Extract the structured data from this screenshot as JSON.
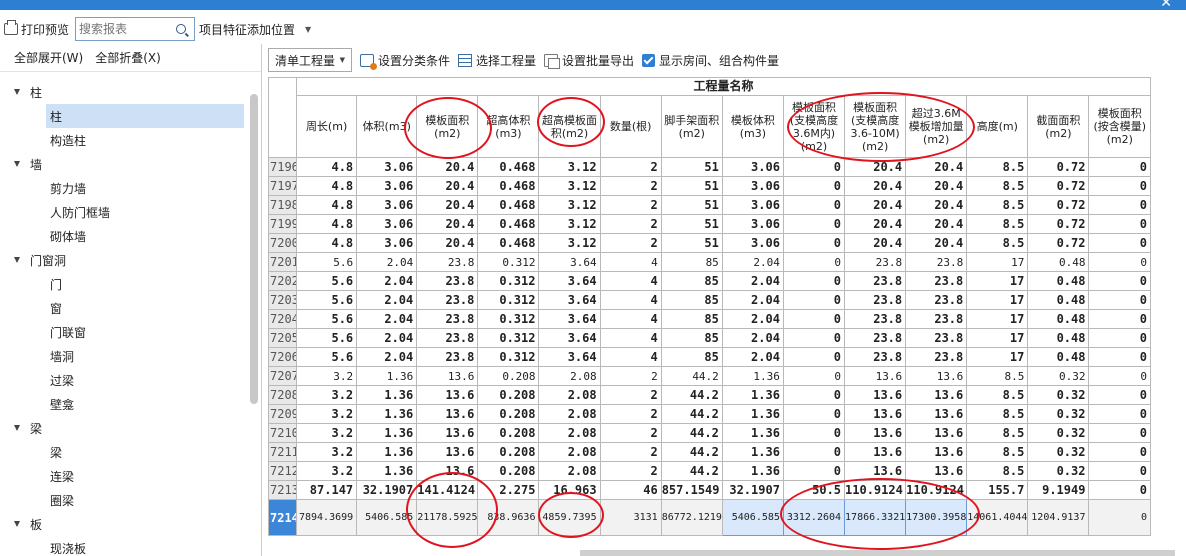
{
  "toolbar": {
    "print_preview": "打印预览",
    "search_placeholder": "搜索报表",
    "feature_add": "项目特征添加位置"
  },
  "left_panel": {
    "expand_all": "全部展开(W)",
    "collapse_all": "全部折叠(X)",
    "tree": [
      {
        "type": "cat",
        "label": "柱"
      },
      {
        "type": "item",
        "label": "柱",
        "selected": true
      },
      {
        "type": "item",
        "label": "构造柱"
      },
      {
        "type": "cat",
        "label": "墙"
      },
      {
        "type": "item",
        "label": "剪力墙"
      },
      {
        "type": "item",
        "label": "人防门框墙"
      },
      {
        "type": "item",
        "label": "砌体墙"
      },
      {
        "type": "cat",
        "label": "门窗洞"
      },
      {
        "type": "item",
        "label": "门"
      },
      {
        "type": "item",
        "label": "窗"
      },
      {
        "type": "item",
        "label": "门联窗"
      },
      {
        "type": "item",
        "label": "墙洞"
      },
      {
        "type": "item",
        "label": "过梁"
      },
      {
        "type": "item",
        "label": "壁龛"
      },
      {
        "type": "cat",
        "label": "梁"
      },
      {
        "type": "item",
        "label": "梁"
      },
      {
        "type": "item",
        "label": "连梁"
      },
      {
        "type": "item",
        "label": "圈梁"
      },
      {
        "type": "cat",
        "label": "板"
      },
      {
        "type": "item",
        "label": "现浇板"
      }
    ]
  },
  "toolbar2": {
    "mode_select": "清单工程量",
    "set_category": "设置分类条件",
    "select_quantity": "选择工程量",
    "batch_export": "设置批量导出",
    "show_rooms": "显示房间、组合构件量"
  },
  "grid": {
    "group_header": "工程量名称",
    "columns": [
      "周长(m)",
      "体积(m3)",
      "模板面积(m2)",
      "超高体积(m3)",
      "超高模板面积(m2)",
      "数量(根)",
      "脚手架面积(m2)",
      "模板体积(m3)",
      "模板面积(支模高度3.6M内)(m2)",
      "模板面积(支模高度3.6-10M)(m2)",
      "超过3.6M模板增加量(m2)",
      "高度(m)",
      "截面面积(m2)",
      "模板面积(按含模量)(m2)"
    ],
    "rows": [
      {
        "no": "7196",
        "style": "b",
        "v": [
          "4.8",
          "3.06",
          "20.4",
          "0.468",
          "3.12",
          "2",
          "51",
          "3.06",
          "0",
          "20.4",
          "20.4",
          "8.5",
          "0.72",
          "0"
        ]
      },
      {
        "no": "7197",
        "style": "b",
        "v": [
          "4.8",
          "3.06",
          "20.4",
          "0.468",
          "3.12",
          "2",
          "51",
          "3.06",
          "0",
          "20.4",
          "20.4",
          "8.5",
          "0.72",
          "0"
        ]
      },
      {
        "no": "7198",
        "style": "b",
        "v": [
          "4.8",
          "3.06",
          "20.4",
          "0.468",
          "3.12",
          "2",
          "51",
          "3.06",
          "0",
          "20.4",
          "20.4",
          "8.5",
          "0.72",
          "0"
        ]
      },
      {
        "no": "7199",
        "style": "b",
        "v": [
          "4.8",
          "3.06",
          "20.4",
          "0.468",
          "3.12",
          "2",
          "51",
          "3.06",
          "0",
          "20.4",
          "20.4",
          "8.5",
          "0.72",
          "0"
        ]
      },
      {
        "no": "7200",
        "style": "b",
        "v": [
          "4.8",
          "3.06",
          "20.4",
          "0.468",
          "3.12",
          "2",
          "51",
          "3.06",
          "0",
          "20.4",
          "20.4",
          "8.5",
          "0.72",
          "0"
        ]
      },
      {
        "no": "7201",
        "style": "n",
        "v": [
          "5.6",
          "2.04",
          "23.8",
          "0.312",
          "3.64",
          "4",
          "85",
          "2.04",
          "0",
          "23.8",
          "23.8",
          "17",
          "0.48",
          "0"
        ]
      },
      {
        "no": "7202",
        "style": "b",
        "v": [
          "5.6",
          "2.04",
          "23.8",
          "0.312",
          "3.64",
          "4",
          "85",
          "2.04",
          "0",
          "23.8",
          "23.8",
          "17",
          "0.48",
          "0"
        ]
      },
      {
        "no": "7203",
        "style": "b",
        "v": [
          "5.6",
          "2.04",
          "23.8",
          "0.312",
          "3.64",
          "4",
          "85",
          "2.04",
          "0",
          "23.8",
          "23.8",
          "17",
          "0.48",
          "0"
        ]
      },
      {
        "no": "7204",
        "style": "b",
        "v": [
          "5.6",
          "2.04",
          "23.8",
          "0.312",
          "3.64",
          "4",
          "85",
          "2.04",
          "0",
          "23.8",
          "23.8",
          "17",
          "0.48",
          "0"
        ]
      },
      {
        "no": "7205",
        "style": "b",
        "v": [
          "5.6",
          "2.04",
          "23.8",
          "0.312",
          "3.64",
          "4",
          "85",
          "2.04",
          "0",
          "23.8",
          "23.8",
          "17",
          "0.48",
          "0"
        ]
      },
      {
        "no": "7206",
        "style": "b",
        "v": [
          "5.6",
          "2.04",
          "23.8",
          "0.312",
          "3.64",
          "4",
          "85",
          "2.04",
          "0",
          "23.8",
          "23.8",
          "17",
          "0.48",
          "0"
        ]
      },
      {
        "no": "7207",
        "style": "n",
        "v": [
          "3.2",
          "1.36",
          "13.6",
          "0.208",
          "2.08",
          "2",
          "44.2",
          "1.36",
          "0",
          "13.6",
          "13.6",
          "8.5",
          "0.32",
          "0"
        ]
      },
      {
        "no": "7208",
        "style": "b",
        "v": [
          "3.2",
          "1.36",
          "13.6",
          "0.208",
          "2.08",
          "2",
          "44.2",
          "1.36",
          "0",
          "13.6",
          "13.6",
          "8.5",
          "0.32",
          "0"
        ]
      },
      {
        "no": "7209",
        "style": "b",
        "v": [
          "3.2",
          "1.36",
          "13.6",
          "0.208",
          "2.08",
          "2",
          "44.2",
          "1.36",
          "0",
          "13.6",
          "13.6",
          "8.5",
          "0.32",
          "0"
        ]
      },
      {
        "no": "7210",
        "style": "b",
        "v": [
          "3.2",
          "1.36",
          "13.6",
          "0.208",
          "2.08",
          "2",
          "44.2",
          "1.36",
          "0",
          "13.6",
          "13.6",
          "8.5",
          "0.32",
          "0"
        ]
      },
      {
        "no": "7211",
        "style": "b",
        "v": [
          "3.2",
          "1.36",
          "13.6",
          "0.208",
          "2.08",
          "2",
          "44.2",
          "1.36",
          "0",
          "13.6",
          "13.6",
          "8.5",
          "0.32",
          "0"
        ]
      },
      {
        "no": "7212",
        "style": "b",
        "v": [
          "3.2",
          "1.36",
          "13.6",
          "0.208",
          "2.08",
          "2",
          "44.2",
          "1.36",
          "0",
          "13.6",
          "13.6",
          "8.5",
          "0.32",
          "0"
        ]
      },
      {
        "no": "7213",
        "style": "b",
        "v": [
          "87.147",
          "32.1907",
          "141.4124",
          "2.275",
          "16.963",
          "46",
          "857.1549",
          "32.1907",
          "50.5",
          "110.9124",
          "110.9124",
          "155.7",
          "9.1949",
          "0"
        ]
      },
      {
        "no": "7214",
        "style": "last",
        "v": [
          "7894.3699",
          "5406.585",
          "21178.5925",
          "838.9636",
          "4859.7395",
          "3131",
          "86772.1219",
          "5406.585",
          "3312.2604",
          "17866.3321",
          "17300.3958",
          "14061.4044",
          "1204.9137",
          "0"
        ]
      }
    ]
  },
  "colors": {
    "accent": "#2d7fd3",
    "annotation_ring": "#e0141e",
    "selected_row": "#3b86d6"
  }
}
